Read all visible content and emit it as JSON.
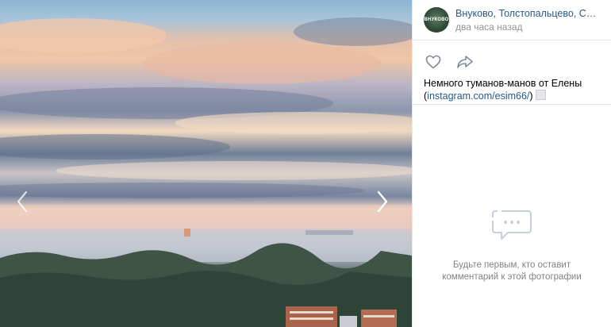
{
  "photo": {
    "prev_icon": "chevron-left-icon",
    "next_icon": "chevron-right-icon"
  },
  "post": {
    "avatar_text": "ВНУКОВО",
    "group_name": "Внуково, Толстопальцево, Солнцево",
    "time": "два часа назад",
    "like_icon": "heart-icon",
    "share_icon": "share-arrow-icon",
    "caption_text": "Немного туманов-манов от Елены",
    "caption_paren_open": "(",
    "caption_link": "instagram.com/esim66/",
    "caption_paren_close": ")"
  },
  "comments": {
    "empty_icon": "comment-bubble-icon",
    "empty_text": "Будьте первым, кто оставит комментарий к этой фотографии"
  }
}
